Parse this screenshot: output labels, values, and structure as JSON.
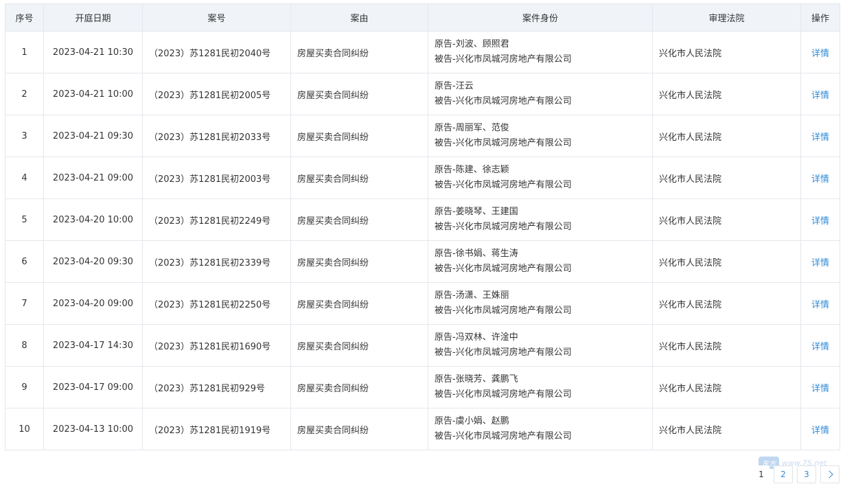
{
  "table": {
    "headers": [
      "序号",
      "开庭日期",
      "案号",
      "案由",
      "案件身份",
      "审理法院",
      "操作"
    ],
    "rows": [
      {
        "no": "1",
        "date": "2023-04-21 10:30",
        "case_no": "（2023）苏1281民初2040号",
        "cause": "房屋买卖合同纠纷",
        "plaintiff": "原告-刘波、顾照君",
        "defendant": "被告-兴化市凤城河房地产有限公司",
        "court": "兴化市人民法院",
        "action": "详情"
      },
      {
        "no": "2",
        "date": "2023-04-21 10:00",
        "case_no": "（2023）苏1281民初2005号",
        "cause": "房屋买卖合同纠纷",
        "plaintiff": "原告-汪云",
        "defendant": "被告-兴化市凤城河房地产有限公司",
        "court": "兴化市人民法院",
        "action": "详情"
      },
      {
        "no": "3",
        "date": "2023-04-21 09:30",
        "case_no": "（2023）苏1281民初2033号",
        "cause": "房屋买卖合同纠纷",
        "plaintiff": "原告-周丽军、范俊",
        "defendant": "被告-兴化市凤城河房地产有限公司",
        "court": "兴化市人民法院",
        "action": "详情"
      },
      {
        "no": "4",
        "date": "2023-04-21 09:00",
        "case_no": "（2023）苏1281民初2003号",
        "cause": "房屋买卖合同纠纷",
        "plaintiff": "原告-陈建、徐志颖",
        "defendant": "被告-兴化市凤城河房地产有限公司",
        "court": "兴化市人民法院",
        "action": "详情"
      },
      {
        "no": "5",
        "date": "2023-04-20 10:00",
        "case_no": "（2023）苏1281民初2249号",
        "cause": "房屋买卖合同纠纷",
        "plaintiff": "原告-姜晓琴、王建国",
        "defendant": "被告-兴化市凤城河房地产有限公司",
        "court": "兴化市人民法院",
        "action": "详情"
      },
      {
        "no": "6",
        "date": "2023-04-20 09:30",
        "case_no": "（2023）苏1281民初2339号",
        "cause": "房屋买卖合同纠纷",
        "plaintiff": "原告-徐书娟、蒋生涛",
        "defendant": "被告-兴化市凤城河房地产有限公司",
        "court": "兴化市人民法院",
        "action": "详情"
      },
      {
        "no": "7",
        "date": "2023-04-20 09:00",
        "case_no": "（2023）苏1281民初2250号",
        "cause": "房屋买卖合同纠纷",
        "plaintiff": "原告-汤潇、王姝丽",
        "defendant": "被告-兴化市凤城河房地产有限公司",
        "court": "兴化市人民法院",
        "action": "详情"
      },
      {
        "no": "8",
        "date": "2023-04-17 14:30",
        "case_no": "（2023）苏1281民初1690号",
        "cause": "房屋买卖合同纠纷",
        "plaintiff": "原告-冯双林、许淦中",
        "defendant": "被告-兴化市凤城河房地产有限公司",
        "court": "兴化市人民法院",
        "action": "详情"
      },
      {
        "no": "9",
        "date": "2023-04-17 09:00",
        "case_no": "（2023）苏1281民初929号",
        "cause": "房屋买卖合同纠纷",
        "plaintiff": "原告-张晓芳、龚鹏飞",
        "defendant": "被告-兴化市凤城河房地产有限公司",
        "court": "兴化市人民法院",
        "action": "详情"
      },
      {
        "no": "10",
        "date": "2023-04-13 10:00",
        "case_no": "（2023）苏1281民初1919号",
        "cause": "房屋买卖合同纠纷",
        "plaintiff": "原告-虞小娟、赵鹏",
        "defendant": "被告-兴化市凤城河房地产有限公司",
        "court": "兴化市人民法院",
        "action": "详情"
      }
    ]
  },
  "pagination": {
    "current": "1",
    "pages": [
      "2",
      "3"
    ],
    "next_icon": "chevron-right-icon"
  },
  "watermark": {
    "badge": "东方",
    "text": "www.7S.net"
  },
  "colors": {
    "header_bg": "#f0f4f8",
    "link": "#2f8ad6",
    "border": "#e4e7ed"
  }
}
